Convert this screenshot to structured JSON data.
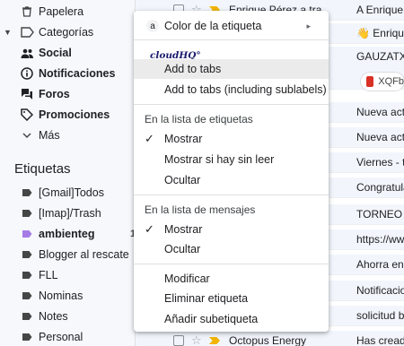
{
  "sidebar": {
    "items": [
      {
        "label": "Papelera",
        "bold": false
      },
      {
        "label": "Categorías",
        "bold": false
      },
      {
        "label": "Social",
        "bold": true
      },
      {
        "label": "Notificaciones",
        "bold": true
      },
      {
        "label": "Foros",
        "bold": true
      },
      {
        "label": "Promociones",
        "bold": true
      },
      {
        "label": "Más",
        "bold": false
      }
    ],
    "labels_title": "Etiquetas",
    "labels": [
      {
        "label": "[Gmail]Todos",
        "bold": false
      },
      {
        "label": "[Imap]/Trash",
        "bold": false
      },
      {
        "label": "ambienteg",
        "bold": true,
        "count": "1"
      },
      {
        "label": "Blogger al rescate",
        "bold": false
      },
      {
        "label": "FLL",
        "bold": false
      },
      {
        "label": "Nominas",
        "bold": false
      },
      {
        "label": "Notes",
        "bold": false
      },
      {
        "label": "Personal",
        "bold": false
      }
    ]
  },
  "mail": {
    "rows": [
      {
        "sender": "Enrique Pérez a tra",
        "subject": "A Enrique Pe"
      },
      {
        "sender": "",
        "subject": "👋 Enrique tu"
      },
      {
        "sender": "",
        "subject": "GAUZATXOA"
      },
      {
        "sender": "",
        "subject": ""
      },
      {
        "sender": "",
        "subject": "Nueva activi"
      },
      {
        "sender": "",
        "subject": "Nueva activi"
      },
      {
        "sender": "",
        "subject": "Viernes - ta"
      },
      {
        "sender": "",
        "subject": "Congratulat"
      },
      {
        "sender": "",
        "subject": "TORNEO GA"
      },
      {
        "sender": "",
        "subject": "https://www"
      },
      {
        "sender": "",
        "subject": "Ahorra en lo"
      },
      {
        "sender": "",
        "subject": "Notificacion"
      },
      {
        "sender": "",
        "subject": "solicitud baj"
      },
      {
        "sender": "",
        "subject": ""
      },
      {
        "sender": "Octopus Energy",
        "subject": "Has creado"
      }
    ],
    "attachment": "XQFb"
  },
  "menu": {
    "label_color": "Color de la etiqueta",
    "label_color_badge": "a",
    "cloudhq": "cloudHQ°",
    "add_to_tabs": "Add to tabs",
    "add_to_tabs_sub": "Add to tabs (including sublabels)",
    "in_label_list": "En la lista de etiquetas",
    "show": "Mostrar",
    "show_if_unread": "Mostrar si hay sin leer",
    "hide": "Ocultar",
    "in_message_list": "En la lista de mensajes",
    "show2": "Mostrar",
    "hide2": "Ocultar",
    "edit": "Modificar",
    "delete": "Eliminar etiqueta",
    "add_sublabel": "Añadir subetiqueta",
    "check_mark": "✓",
    "submenu_arrow": "▸"
  }
}
